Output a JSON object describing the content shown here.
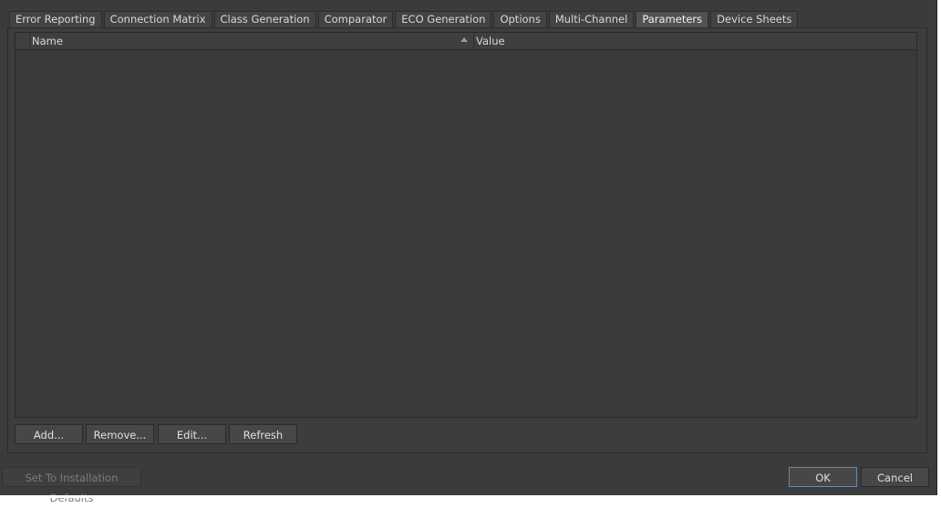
{
  "tabs": [
    {
      "label": "Error Reporting"
    },
    {
      "label": "Connection Matrix"
    },
    {
      "label": "Class Generation"
    },
    {
      "label": "Comparator"
    },
    {
      "label": "ECO Generation"
    },
    {
      "label": "Options"
    },
    {
      "label": "Multi-Channel"
    },
    {
      "label": "Parameters",
      "active": true
    },
    {
      "label": "Device Sheets"
    }
  ],
  "grid": {
    "columns": [
      {
        "label": "Name",
        "sorted": "ascending"
      },
      {
        "label": "Value"
      }
    ],
    "rows": []
  },
  "actions": {
    "add": "Add...",
    "remove": "Remove...",
    "edit": "Edit...",
    "refresh": "Refresh"
  },
  "footer": {
    "defaults": "Set To Installation Defaults",
    "ok": "OK",
    "cancel": "Cancel"
  }
}
